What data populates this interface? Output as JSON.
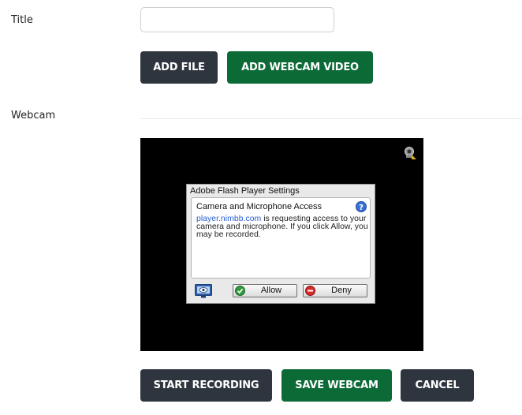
{
  "form": {
    "title_label": "Title",
    "title_value": "",
    "webcam_label": "Webcam"
  },
  "buttons": {
    "add_file": "ADD FILE",
    "add_webcam_video": "ADD WEBCAM VIDEO",
    "start_recording": "START RECORDING",
    "save_webcam": "SAVE WEBCAM",
    "cancel": "CANCEL"
  },
  "flash_dialog": {
    "title": "Adobe Flash Player Settings",
    "heading": "Camera and Microphone Access",
    "domain": "player.nimbb.com",
    "message": " is requesting access to your camera and microphone. If you click Allow, you may be recorded.",
    "allow_label": "Allow",
    "deny_label": "Deny"
  },
  "icons": {
    "camera": "webcam-settings-icon",
    "help": "help-icon",
    "monitor": "monitor-icon",
    "allow": "green-check-icon",
    "deny": "red-deny-icon"
  },
  "colors": {
    "dark_button": "#2f353e",
    "green_button": "#0c6a37",
    "webcam_background": "#000000",
    "link": "#2a5fcf"
  }
}
